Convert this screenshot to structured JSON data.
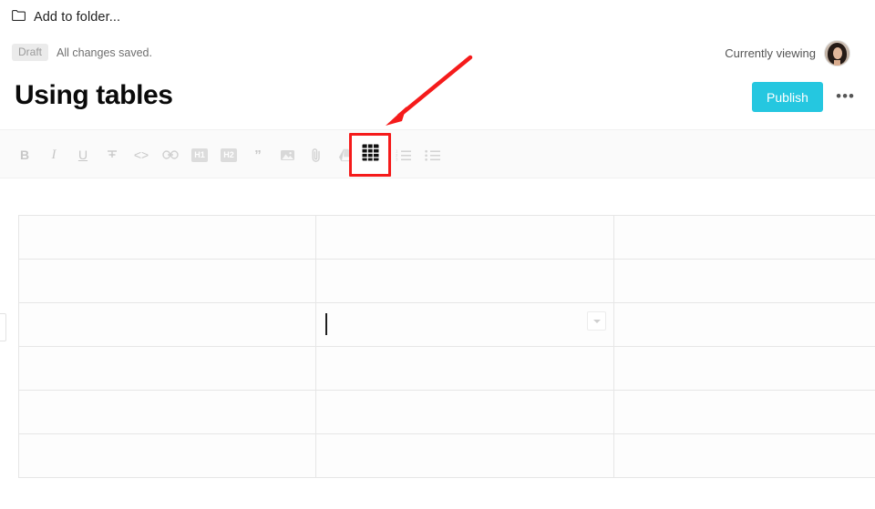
{
  "topbar": {
    "folder_button_label": "Add to folder...",
    "folder_icon": "folder-icon"
  },
  "status": {
    "badge": "Draft",
    "saved_text": "All changes saved."
  },
  "viewing": {
    "label": "Currently viewing",
    "avatar": "user-avatar"
  },
  "document": {
    "title": "Using tables"
  },
  "actions": {
    "publish_label": "Publish",
    "publish_color": "#25c7e0",
    "more_label": "•••"
  },
  "toolbar": {
    "items": [
      {
        "name": "bold",
        "label": "B",
        "kind": "text"
      },
      {
        "name": "italic",
        "label": "I",
        "kind": "text"
      },
      {
        "name": "underline",
        "label": "U",
        "kind": "text"
      },
      {
        "name": "strikethrough",
        "label": "",
        "kind": "icon"
      },
      {
        "name": "code",
        "label": "<>",
        "kind": "text"
      },
      {
        "name": "link",
        "label": "",
        "kind": "icon"
      },
      {
        "name": "heading-1",
        "label": "H1",
        "kind": "badge"
      },
      {
        "name": "heading-2",
        "label": "H2",
        "kind": "badge"
      },
      {
        "name": "blockquote",
        "label": "”",
        "kind": "text"
      },
      {
        "name": "image",
        "label": "",
        "kind": "icon"
      },
      {
        "name": "attachment",
        "label": "",
        "kind": "icon"
      },
      {
        "name": "google-drive",
        "label": "",
        "kind": "icon"
      },
      {
        "name": "table",
        "label": "",
        "kind": "icon",
        "active": true
      },
      {
        "name": "ordered-list",
        "label": "",
        "kind": "icon"
      },
      {
        "name": "bulleted-list",
        "label": "",
        "kind": "icon"
      }
    ]
  },
  "annotation": {
    "color": "#f51b1b",
    "highlight_target": "table-toolbar-button",
    "arrow": "points-to-table-button"
  },
  "table": {
    "rows": 6,
    "columns": 3,
    "cells": [
      [
        "",
        "",
        ""
      ],
      [
        "",
        "",
        ""
      ],
      [
        "",
        "",
        ""
      ],
      [
        "",
        "",
        ""
      ],
      [
        "",
        "",
        ""
      ],
      [
        "",
        "",
        ""
      ]
    ],
    "active_cell": {
      "row": 2,
      "col": 1
    },
    "cell_menu_icon": "chevron-down-icon",
    "row_handle_icon": "row-handle"
  }
}
